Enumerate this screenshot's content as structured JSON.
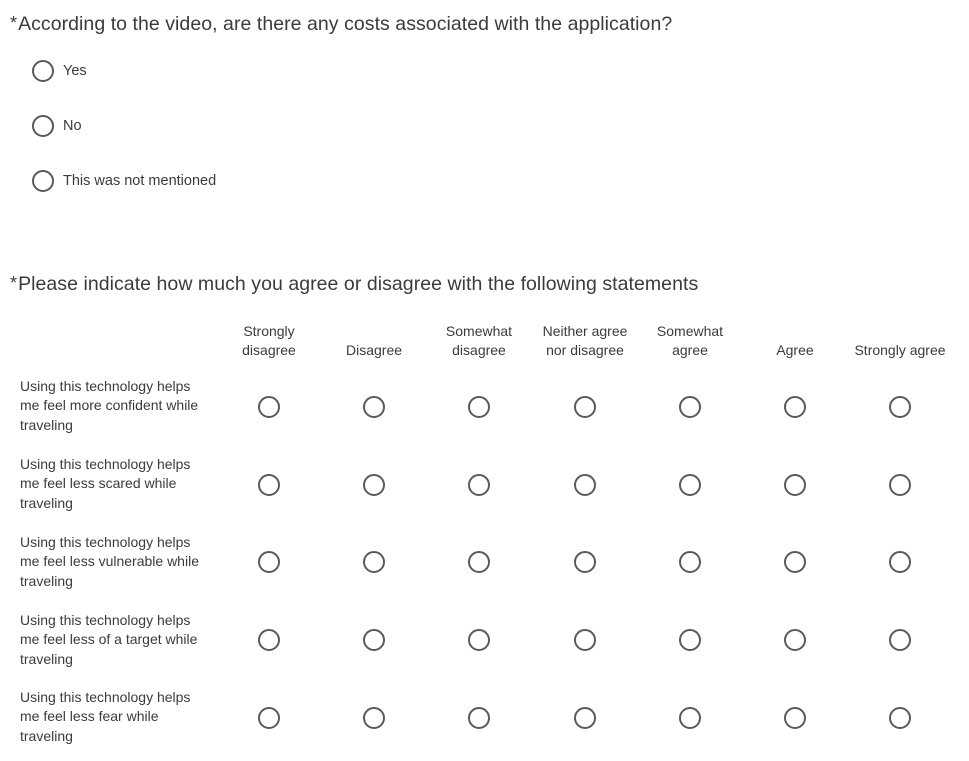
{
  "question1": {
    "required_marker": "*",
    "text": "According to the video, are there any costs associated with the application?",
    "choices": [
      "Yes",
      "No",
      "This was not mentioned"
    ]
  },
  "question2": {
    "required_marker": "*",
    "text": "Please indicate how much you agree or disagree with the following statements",
    "scale": [
      "Strongly disagree",
      "Disagree",
      "Somewhat disagree",
      "Neither agree nor disagree",
      "Somewhat agree",
      "Agree",
      "Strongly agree"
    ],
    "statements": [
      "Using this technology helps me feel more confident while traveling",
      "Using this technology helps me feel less scared while traveling",
      "Using this technology helps me feel less vulnerable while traveling",
      "Using this technology helps me feel less of a target while traveling",
      "Using this technology helps me feel less fear while traveling"
    ]
  },
  "colors": {
    "text": "#3b3b3b",
    "radio_border": "#5a5a5a",
    "background": "#ffffff"
  }
}
